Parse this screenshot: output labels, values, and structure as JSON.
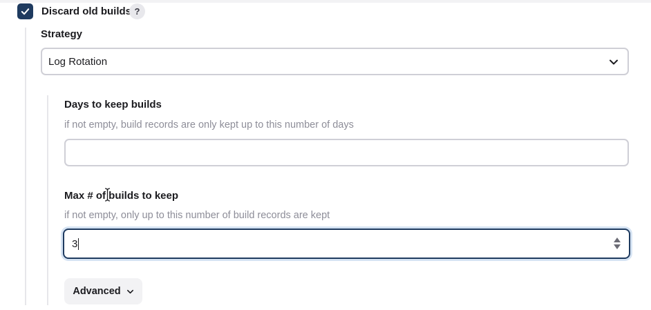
{
  "discard": {
    "checked": true,
    "label": "Discard old builds",
    "help": "?"
  },
  "strategy": {
    "label": "Strategy",
    "selected": "Log Rotation"
  },
  "days_to_keep": {
    "label": "Days to keep builds",
    "help": "if not empty, build records are only kept up to this number of days",
    "value": ""
  },
  "max_builds": {
    "label": "Max # of builds to keep",
    "help": "if not empty, only up to this number of build records are kept",
    "value": "3"
  },
  "advanced": {
    "label": "Advanced"
  },
  "icons": {
    "checkbox": "check-icon",
    "select": "chevron-down-icon",
    "spinner": "spinner-arrows-icon",
    "cursor": "text-cursor-icon",
    "advanced": "chevron-down-icon"
  },
  "colors": {
    "accent": "#1e3a5f",
    "focus_ring": "#d5e3f3",
    "help_text": "#8d8d98",
    "border": "#cfcfd6"
  }
}
